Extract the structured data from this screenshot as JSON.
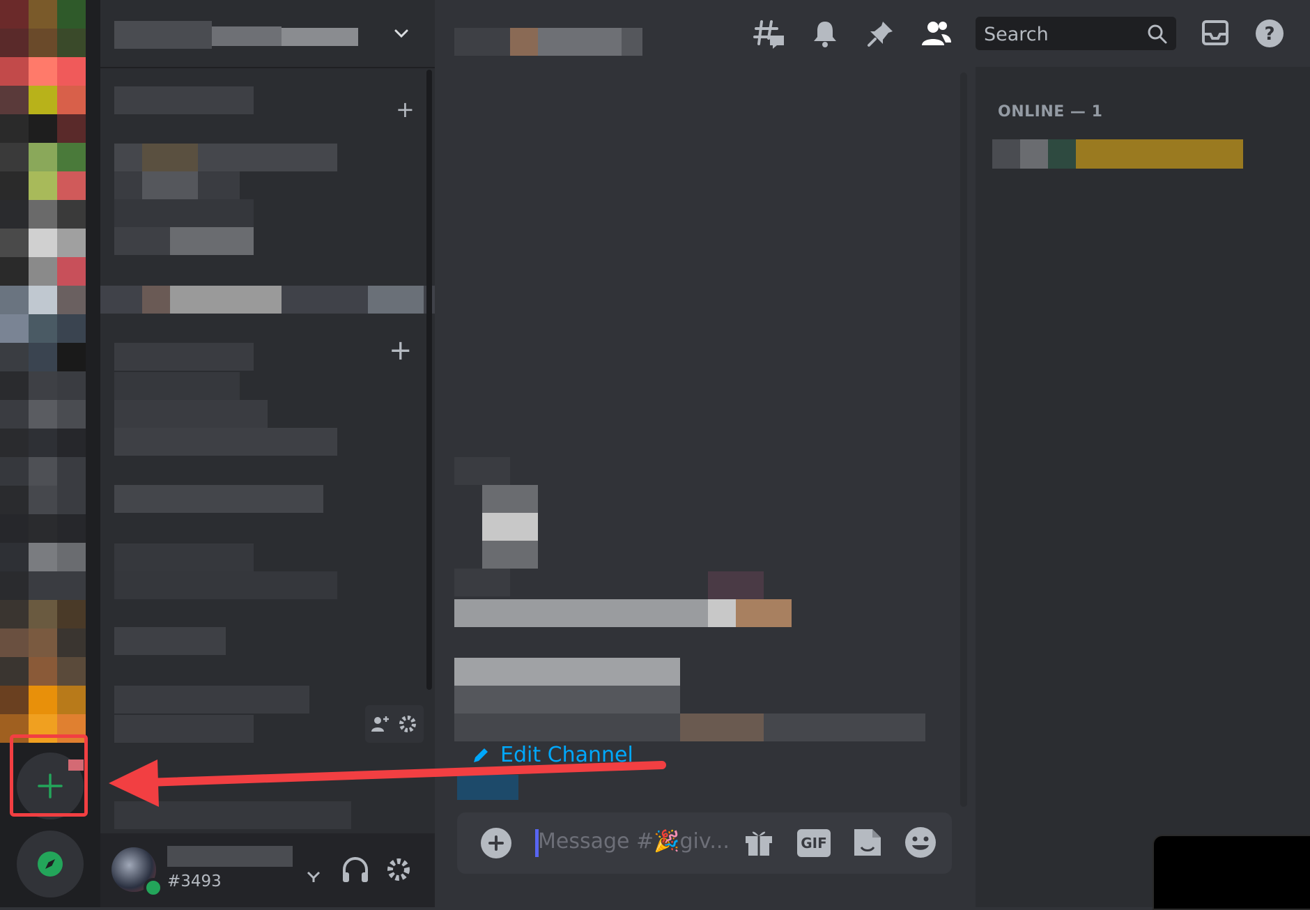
{
  "header": {
    "search_placeholder": "Search"
  },
  "members": {
    "online_heading": "ONLINE — 1"
  },
  "chat": {
    "edit_channel_label": "Edit Channel"
  },
  "composer": {
    "placeholder": "Message #🎉giv..."
  },
  "user_panel": {
    "user_tag": "#3493"
  },
  "icons": {
    "add_server": "plus-icon",
    "discover": "compass-icon",
    "threads": "threads-icon",
    "notifications": "bell-icon",
    "pins": "pin-icon",
    "members": "members-icon",
    "inbox": "inbox-icon",
    "help": "help-icon",
    "gift": "gift-icon",
    "gif": "GIF",
    "sticker": "sticker-icon",
    "emoji": "emoji-icon"
  },
  "colors": {
    "accent_green": "#23a55a",
    "link_blue": "#00a8fc",
    "annotation_red": "#f23f42",
    "status_online": "#23a55a"
  }
}
